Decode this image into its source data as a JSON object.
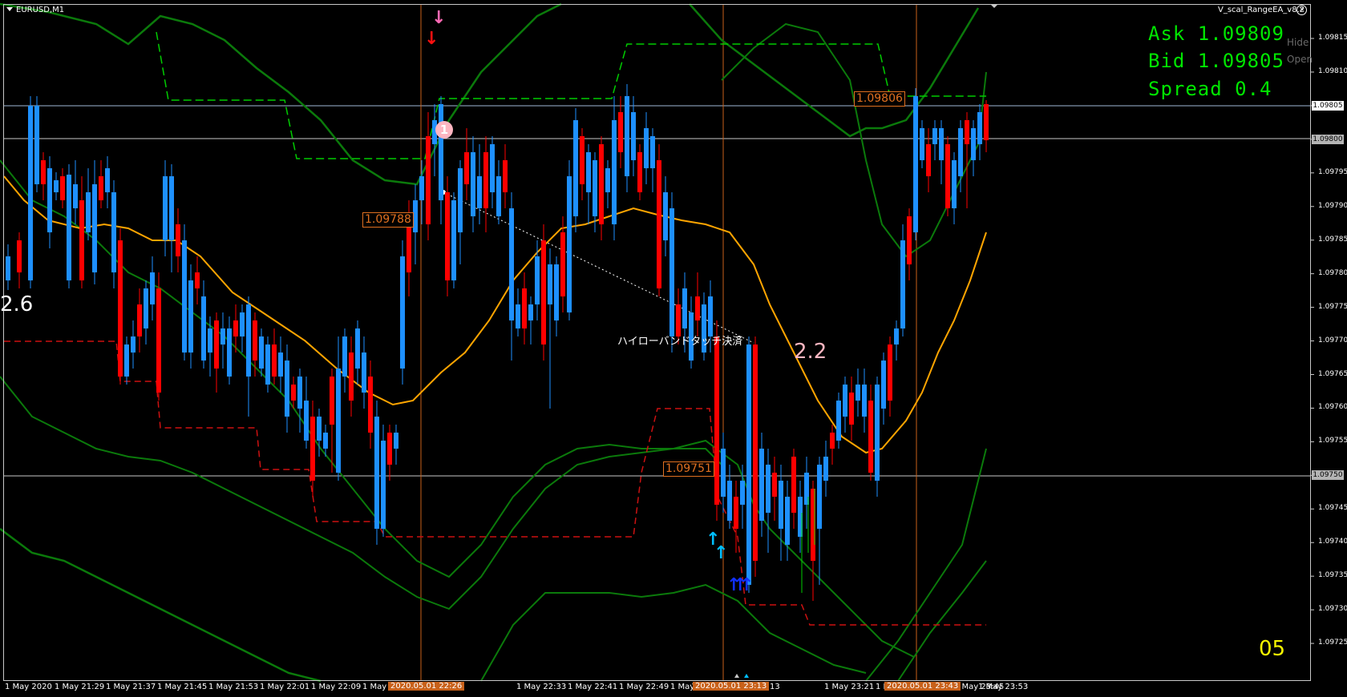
{
  "window": {
    "symbol": "EURUSD,M1",
    "ea_name": "V_scal_RangeEA_v8.2",
    "close_glyph": "×"
  },
  "quotes": {
    "ask": "Ask 1.09809",
    "bid": "Bid 1.09805",
    "spread": "Spread 0.4"
  },
  "side_buttons": {
    "hide": "Hide",
    "open": "Open"
  },
  "price_axis": {
    "ticks": [
      "1.09815",
      "1.09810",
      "1.09805",
      "1.09800",
      "1.09795",
      "1.09790",
      "1.09785",
      "1.09780",
      "1.09775",
      "1.09770",
      "1.09765",
      "1.09760",
      "1.09755",
      "1.09750",
      "1.09745",
      "1.09740",
      "1.09735",
      "1.09730",
      "1.09725"
    ],
    "highlight_white": "1.09805",
    "highlight_grey": [
      "1.09800",
      "1.09750"
    ]
  },
  "time_axis": {
    "ticks": [
      "1 May 2020",
      "1 May 21:29",
      "1 May 21:37",
      "1 May 21:45",
      "1 May 21:53",
      "1 May 22:01",
      "1 May 22:09",
      "1 May 2",
      "5",
      "1 May 22:33",
      "1 May 22:41",
      "1 May 22:49",
      "1 May 22:57",
      "1 Ma",
      "13",
      "1 May 23:21",
      "1 May 23:29",
      "1",
      "1 May 23:45",
      "1 May 23:53"
    ],
    "marks": [
      "2020.05.01 22:26",
      "2020.05.01 23:13",
      "2020.05.01 23:43"
    ]
  },
  "labels": {
    "price_a": "1.09788",
    "price_b": "1.09751",
    "price_c": "1.09806",
    "left_number": "2.6",
    "right_number": "2.2",
    "jp_note": "ハイローバンドタッチ決済",
    "bar_count": "05",
    "circle": "1"
  },
  "colors": {
    "bull_candle": "#1e90ff",
    "bear_candle": "#ff0000",
    "ma_line": "#ffa500",
    "band_outer": "#0b7a0b",
    "band_dashed": "#00cc00",
    "red_dashed": "#cc1111",
    "vline": "#c8611a",
    "hline": "#c8c8c8",
    "quote_text": "#00e600"
  },
  "icons": {
    "sell_arrow": "down-arrow-icon",
    "buy_arrow": "up-arrow-icon"
  }
}
